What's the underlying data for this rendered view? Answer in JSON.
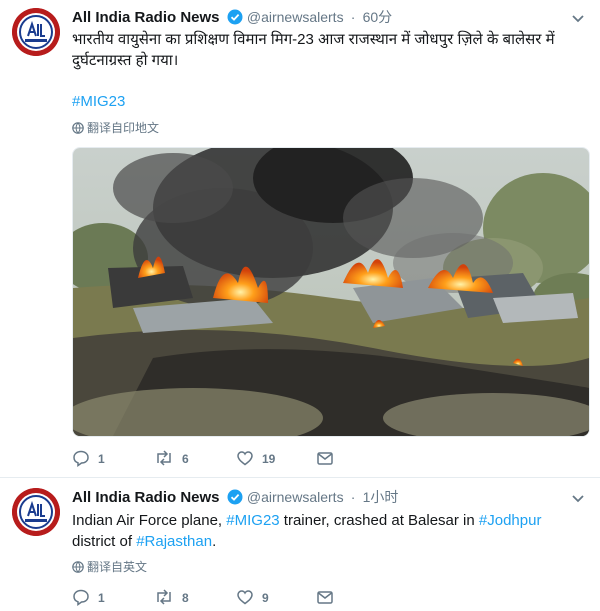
{
  "tweets": [
    {
      "author_name": "All India Radio News",
      "handle": "@airnewsalerts",
      "separator": "·",
      "time": "60分",
      "text": "भारतीय वायुसेना का प्रशिक्षण विमान मिग-23 आज राजस्थान में जोधपुर ज़िले के बालेसर में दुर्घटनाग्रस्त हो गया।",
      "hashtag": "#MIG23",
      "translate_label": "翻译自印地文",
      "image_alt": "burning aircraft wreckage in a field",
      "replies": "1",
      "retweets": "6",
      "likes": "19"
    },
    {
      "author_name": "All India Radio News",
      "handle": "@airnewsalerts",
      "separator": "·",
      "time": "1小时",
      "text_parts": [
        "Indian Air Force plane, ",
        "#MIG23",
        " trainer, crashed at Balesar in ",
        "#Jodhpur",
        " district of ",
        "#Rajasthan",
        "."
      ],
      "translate_label": "翻译自英文",
      "replies": "1",
      "retweets": "8",
      "likes": "9"
    }
  ],
  "colors": {
    "link": "#1da1f2",
    "muted": "#657786",
    "verified": "#1da1f2",
    "avatar": "#b71c1c"
  },
  "icons": [
    "verified-badge-icon",
    "chevron-down-icon",
    "globe-icon",
    "reply-icon",
    "retweet-icon",
    "like-icon",
    "share-icon"
  ]
}
